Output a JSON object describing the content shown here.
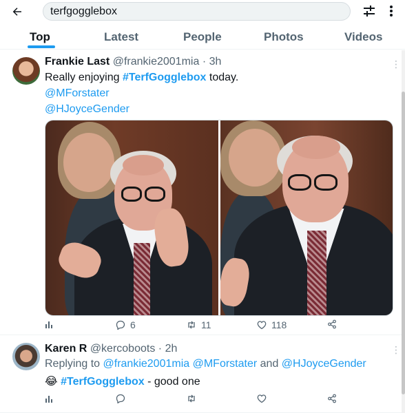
{
  "search": {
    "value": "terfgogglebox"
  },
  "tabs": [
    {
      "label": "Top"
    },
    {
      "label": "Latest"
    },
    {
      "label": "People"
    },
    {
      "label": "Photos"
    },
    {
      "label": "Videos"
    }
  ],
  "tweets": [
    {
      "name": "Frankie Last",
      "handle": "@frankie2001mia",
      "sep": "·",
      "time": "3h",
      "text_prefix": "Really enjoying ",
      "hashtag": "#TerfGogglebox",
      "text_suffix": " today.",
      "mentions": [
        "@MForstater",
        "@HJoyceGender"
      ],
      "stats": {
        "views": "",
        "replies": "6",
        "retweets": "11",
        "likes": "118"
      }
    },
    {
      "name": "Karen R",
      "handle": "@kercoboots",
      "sep": "·",
      "time": "2h",
      "replying_prefix": "Replying to ",
      "replying_to": [
        "@frankie2001mia",
        "@MForstater",
        "@HJoyceGender"
      ],
      "and_word": "and",
      "emoji": "😂",
      "hashtag": "#TerfGogglebox",
      "text_suffix": " - good one",
      "stats": {
        "views": "",
        "replies": "",
        "retweets": "",
        "likes": ""
      }
    }
  ],
  "icons": {
    "back": "back-arrow-icon",
    "filter": "filter-sliders-icon",
    "more": "more-vertical-icon",
    "views": "analytics-icon",
    "reply": "reply-icon",
    "retweet": "retweet-icon",
    "like": "heart-icon",
    "share": "share-icon"
  },
  "colors": {
    "accent": "#1d9bf0",
    "text": "#0f1419",
    "muted": "#536471"
  }
}
